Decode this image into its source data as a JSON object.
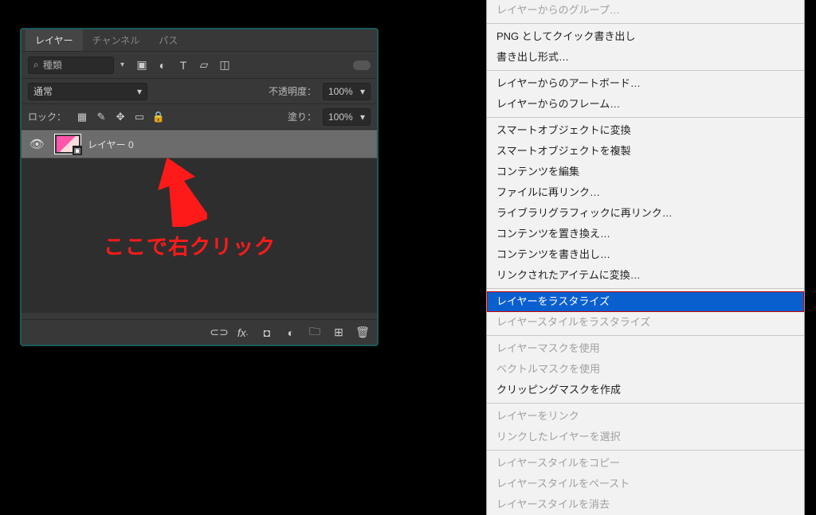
{
  "panel": {
    "tabs": {
      "layers": "レイヤー",
      "channels": "チャンネル",
      "paths": "パス"
    },
    "filter": {
      "search_icon": "⌕",
      "placeholder": "種類"
    },
    "blend": {
      "mode": "通常",
      "opacity_label": "不透明度：",
      "opacity_value": "100%"
    },
    "lock": {
      "label": "ロック：",
      "fill_label": "塗り：",
      "fill_value": "100%"
    },
    "layer0": {
      "name": "レイヤー 0"
    }
  },
  "annotation": {
    "text": "ここで右クリック"
  },
  "menu": {
    "group1": [
      {
        "label": "レイヤーからのグループ…",
        "enabled": false
      }
    ],
    "group2": [
      {
        "label": "PNG としてクイック書き出し",
        "enabled": true
      },
      {
        "label": "書き出し形式…",
        "enabled": true
      }
    ],
    "group3": [
      {
        "label": "レイヤーからのアートボード…",
        "enabled": true
      },
      {
        "label": "レイヤーからのフレーム…",
        "enabled": true
      }
    ],
    "group4": [
      {
        "label": "スマートオブジェクトに変換",
        "enabled": true
      },
      {
        "label": "スマートオブジェクトを複製",
        "enabled": true
      },
      {
        "label": "コンテンツを編集",
        "enabled": true
      },
      {
        "label": "ファイルに再リンク…",
        "enabled": true
      },
      {
        "label": "ライブラリグラフィックに再リンク…",
        "enabled": true
      },
      {
        "label": "コンテンツを置き換え…",
        "enabled": true
      },
      {
        "label": "コンテンツを書き出し…",
        "enabled": true
      },
      {
        "label": "リンクされたアイテムに変換…",
        "enabled": true
      }
    ],
    "highlighted": {
      "label": "レイヤーをラスタライズ"
    },
    "after_hl": [
      {
        "label": "レイヤースタイルをラスタライズ",
        "enabled": false
      }
    ],
    "group5": [
      {
        "label": "レイヤーマスクを使用",
        "enabled": false
      },
      {
        "label": "ベクトルマスクを使用",
        "enabled": false
      },
      {
        "label": "クリッピングマスクを作成",
        "enabled": true
      }
    ],
    "group6": [
      {
        "label": "レイヤーをリンク",
        "enabled": false
      },
      {
        "label": "リンクしたレイヤーを選択",
        "enabled": false
      }
    ],
    "group7": [
      {
        "label": "レイヤースタイルをコピー",
        "enabled": false
      },
      {
        "label": "レイヤースタイルをペースト",
        "enabled": false
      },
      {
        "label": "レイヤースタイルを消去",
        "enabled": false
      }
    ]
  }
}
